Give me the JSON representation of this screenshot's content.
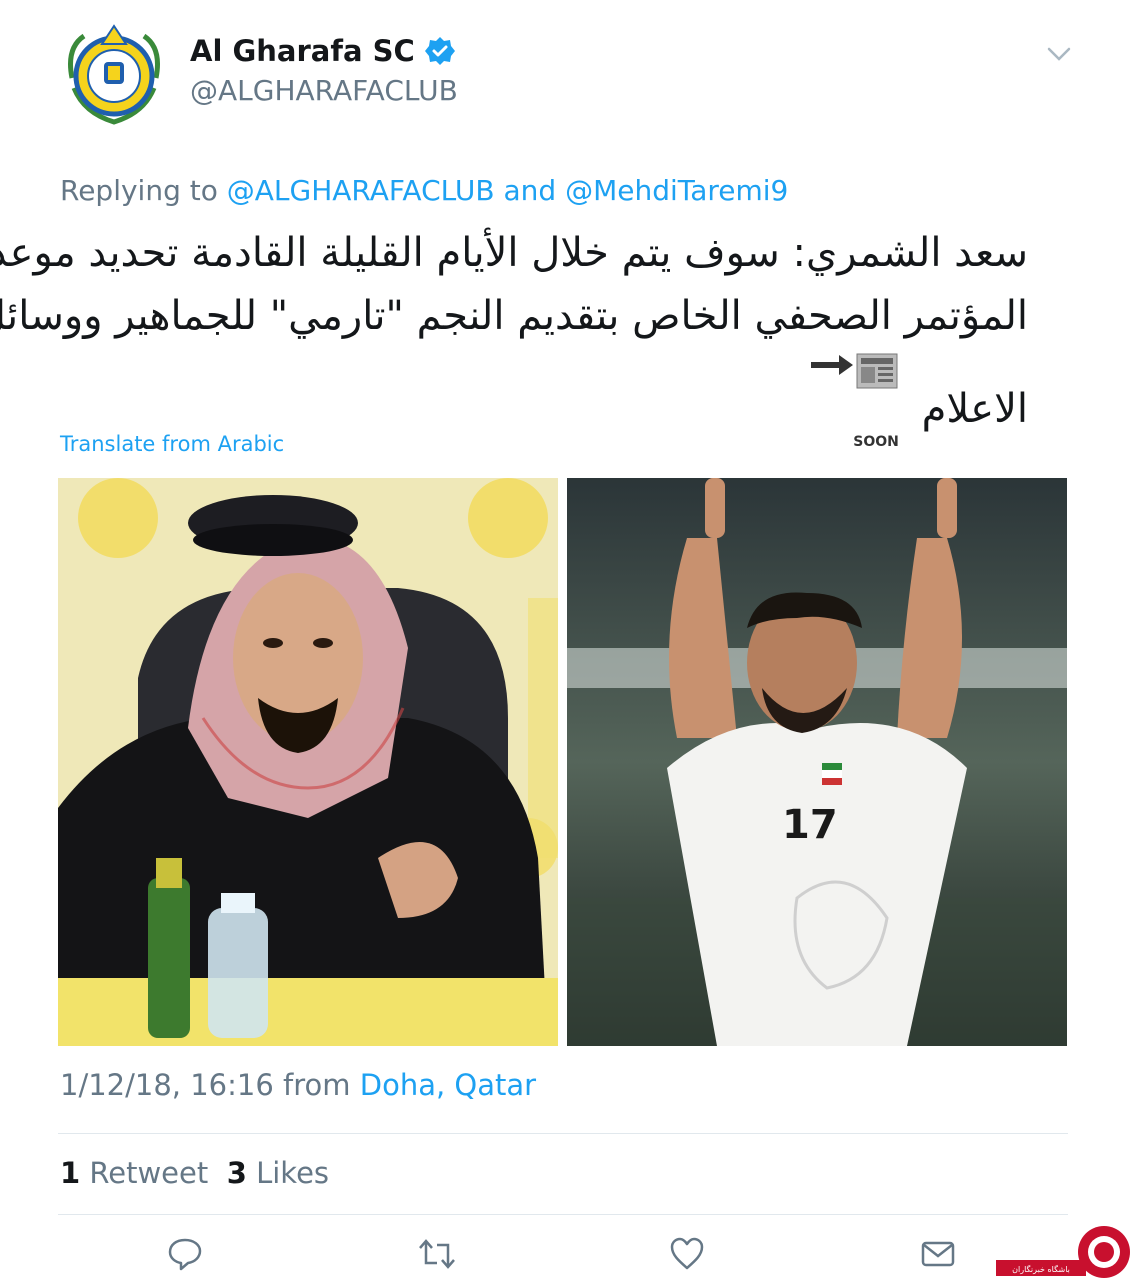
{
  "account": {
    "name": "Al Gharafa SC",
    "handle": "@ALGHARAFACLUB",
    "verified": true
  },
  "reply": {
    "prefix": "Replying to",
    "user1": "@ALGHARAFACLUB",
    "conjunction": "and",
    "user2": "@MehdiTaremi9"
  },
  "tweet": {
    "line1": "سعد الشمري: سوف يتم خلال الأيام القليلة القادمة تحديد موعد",
    "line2": "المؤتمر الصحفي  الخاص بتقديم النجم \"تارمي\" للجماهير ووسائل",
    "line3": "الاعلام",
    "soon_label": "SOON"
  },
  "translate_label": "Translate from Arabic",
  "meta": {
    "datetime": "1/12/18, 16:16",
    "from": "from",
    "location": "Doha, Qatar"
  },
  "stats": {
    "retweets": "1",
    "retweets_label": "Retweet",
    "likes": "3",
    "likes_label": "Likes"
  },
  "icons": [
    "chevron-down-icon",
    "reply-icon",
    "retweet-icon",
    "like-icon",
    "message-icon",
    "verified-icon"
  ],
  "colors": {
    "link": "#1da1f2",
    "muted": "#657786",
    "text": "#14171a",
    "club_yellow": "#f5d31c",
    "club_blue": "#1f5fae"
  },
  "watermark": {
    "label": "باشگاه خبرنگاران"
  }
}
